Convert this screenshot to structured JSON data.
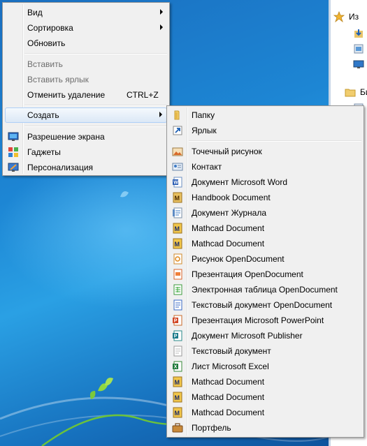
{
  "context_menu": {
    "items": [
      {
        "label": "Вид",
        "submenu": true
      },
      {
        "label": "Сортировка",
        "submenu": true
      },
      {
        "label": "Обновить"
      },
      {
        "label": "Вставить",
        "disabled": true
      },
      {
        "label": "Вставить ярлык",
        "disabled": true
      },
      {
        "label": "Отменить удаление",
        "shortcut": "CTRL+Z"
      },
      {
        "label": "Создать",
        "submenu": true,
        "highlighted": true
      },
      {
        "label": "Разрешение экрана",
        "icon": "screen-resolution-icon"
      },
      {
        "label": "Гаджеты",
        "icon": "gadgets-icon"
      },
      {
        "label": "Персонализация",
        "icon": "personalization-icon"
      }
    ]
  },
  "new_submenu": {
    "items": [
      {
        "label": "Папку",
        "icon": "folder-icon"
      },
      {
        "label": "Ярлык",
        "icon": "shortcut-icon"
      },
      {
        "label": "Точечный рисунок",
        "icon": "bitmap-icon"
      },
      {
        "label": "Контакт",
        "icon": "contact-icon"
      },
      {
        "label": "Документ Microsoft Word",
        "icon": "word-icon"
      },
      {
        "label": "Handbook Document",
        "icon": "handbook-icon"
      },
      {
        "label": "Документ Журнала",
        "icon": "journal-icon"
      },
      {
        "label": "Mathcad Document",
        "icon": "mathcad-icon"
      },
      {
        "label": "Mathcad Document",
        "icon": "mathcad-icon"
      },
      {
        "label": "Рисунок OpenDocument",
        "icon": "opendocument-drawing-icon"
      },
      {
        "label": "Презентация OpenDocument",
        "icon": "opendocument-presentation-icon"
      },
      {
        "label": "Электронная таблица OpenDocument",
        "icon": "opendocument-spreadsheet-icon"
      },
      {
        "label": "Текстовый документ OpenDocument",
        "icon": "opendocument-text-icon"
      },
      {
        "label": "Презентация Microsoft PowerPoint",
        "icon": "powerpoint-icon"
      },
      {
        "label": "Документ Microsoft Publisher",
        "icon": "publisher-icon"
      },
      {
        "label": "Текстовый документ",
        "icon": "text-document-icon"
      },
      {
        "label": "Лист Microsoft Excel",
        "icon": "excel-icon"
      },
      {
        "label": "Mathcad Document",
        "icon": "mathcad-icon"
      },
      {
        "label": "Mathcad Document",
        "icon": "mathcad-icon"
      },
      {
        "label": "Mathcad Document",
        "icon": "mathcad-icon"
      },
      {
        "label": "Портфель",
        "icon": "briefcase-icon"
      }
    ]
  },
  "explorer": {
    "items": [
      {
        "label": "Из",
        "icon": "favorites-star-icon"
      },
      {
        "label": "",
        "icon": "downloads-icon"
      },
      {
        "label": "",
        "icon": "recent-places-icon"
      },
      {
        "label": "",
        "icon": "desktop-icon"
      },
      {
        "label": "Би",
        "icon": "libraries-icon"
      }
    ]
  },
  "colors": {
    "menu_bg": "#f0f0f0",
    "highlight_border": "#aecff7",
    "desktop": "#1d86d4"
  }
}
